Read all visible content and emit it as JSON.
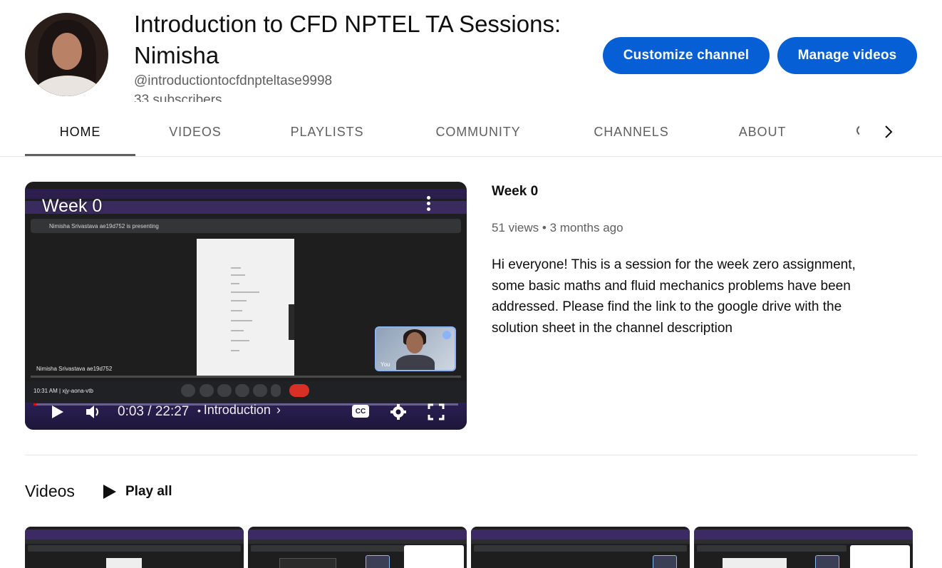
{
  "channel": {
    "title": "Introduction to CFD NPTEL TA Sessions: Nimisha",
    "handle": "@introductiontocfdnpteltase9998",
    "subscribers": "33 subscribers"
  },
  "buttons": {
    "customize": "Customize channel",
    "manage": "Manage videos"
  },
  "tabs": [
    {
      "label": "HOME",
      "active": true
    },
    {
      "label": "VIDEOS",
      "active": false
    },
    {
      "label": "PLAYLISTS",
      "active": false
    },
    {
      "label": "COMMUNITY",
      "active": false
    },
    {
      "label": "CHANNELS",
      "active": false
    },
    {
      "label": "ABOUT",
      "active": false
    }
  ],
  "featured": {
    "player_title": "Week 0",
    "current_time": "0:03 / 22:27",
    "chapter": "Introduction",
    "cc_label": "CC",
    "embedded": {
      "presenting": "Nimisha Srivastava ae19d752 is presenting",
      "name_label": "Nimisha Srivastava ae19d752",
      "clock": "10:31 AM  |  xjy-aona-vtb",
      "you_label": "You"
    },
    "title": "Week 0",
    "views": "51 views",
    "age": "3 months ago",
    "description": "Hi everyone! This is a session for the week zero assignment, some basic maths and fluid mechanics problems have been addressed. Please find the link to the google drive with the solution sheet in the channel description"
  },
  "shelf": {
    "title": "Videos",
    "play_all": "Play all"
  },
  "colors": {
    "primary_button": "#065fd4",
    "text_primary": "#0f0f0f",
    "text_secondary": "#606060",
    "progress_red": "#ff0000"
  }
}
